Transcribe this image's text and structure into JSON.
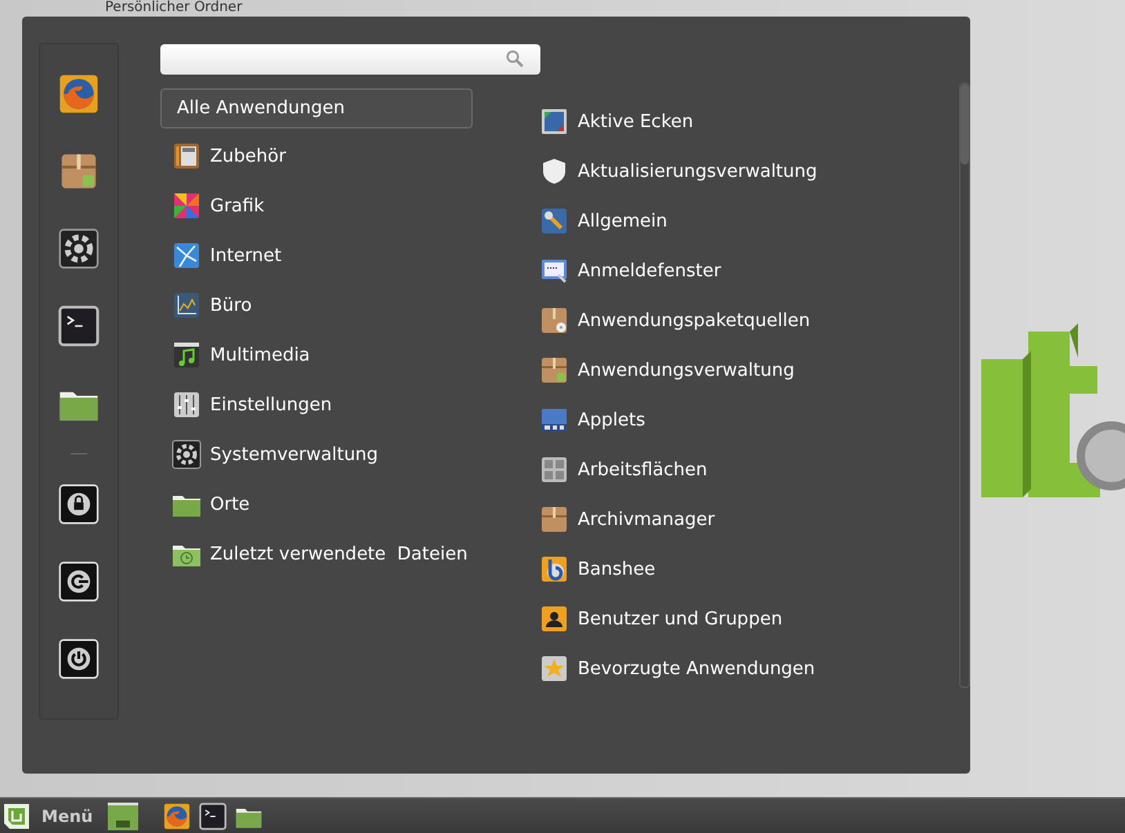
{
  "desktop": {
    "icon_label": "Persönlicher Ordner"
  },
  "menu": {
    "favorites": [
      {
        "kind": "app"
      },
      {
        "kind": "app"
      },
      {
        "kind": "app"
      },
      {
        "kind": "app"
      },
      {
        "kind": "app"
      },
      {
        "kind": "separator"
      },
      {
        "kind": "app"
      },
      {
        "kind": "app"
      },
      {
        "kind": "app"
      }
    ],
    "categories": [
      {
        "label": "Alle Anwendungen",
        "selected": true
      },
      {
        "label": "Zubehör",
        "selected": false
      },
      {
        "label": "Grafik",
        "selected": false
      },
      {
        "label": "Internet",
        "selected": false
      },
      {
        "label": "Büro",
        "selected": false
      },
      {
        "label": "Multimedia",
        "selected": false
      },
      {
        "label": "Einstellungen",
        "selected": false
      },
      {
        "label": "Systemverwaltung",
        "selected": false
      },
      {
        "label": "Orte",
        "selected": false
      },
      {
        "label": "Zuletzt verwendete  Dateien",
        "selected": false
      }
    ],
    "applications": [
      {
        "label": "Aktive Ecken"
      },
      {
        "label": "Aktualisierungsverwaltung"
      },
      {
        "label": "Allgemein"
      },
      {
        "label": "Anmeldefenster"
      },
      {
        "label": "Anwendungspaketquellen"
      },
      {
        "label": "Anwendungsverwaltung"
      },
      {
        "label": "Applets"
      },
      {
        "label": "Arbeitsflächen"
      },
      {
        "label": "Archivmanager"
      },
      {
        "label": "Banshee"
      },
      {
        "label": "Benutzer und Gruppen"
      },
      {
        "label": "Bevorzugte Anwendungen"
      }
    ]
  },
  "taskbar": {
    "menu_label": "Menü"
  }
}
